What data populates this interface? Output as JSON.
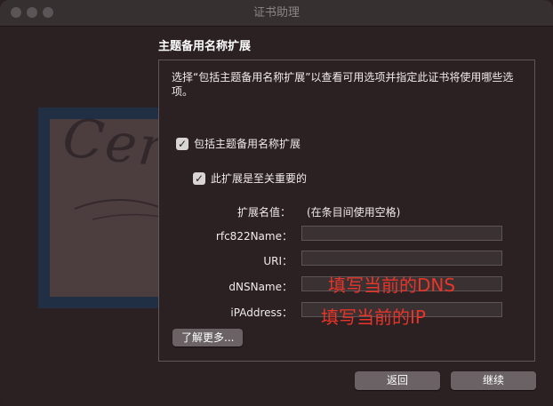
{
  "window": {
    "title": "证书助理"
  },
  "section": {
    "heading": "主题备用名称扩展",
    "description": "选择“包括主题备用名称扩展”以查看可用选项并指定此证书将使用哪些选项。"
  },
  "illustration": {
    "cert_text": "Certificate"
  },
  "options": {
    "include_ext": {
      "label": "包括主题备用名称扩展",
      "checked": true,
      "mark": "✓"
    },
    "critical_ext": {
      "label": "此扩展是至关重要的",
      "checked": true,
      "mark": "✓"
    }
  },
  "ext_values": {
    "label": "扩展名值：",
    "hint": "(在条目间使用空格)"
  },
  "fields": [
    {
      "label": "rfc822Name：",
      "value": ""
    },
    {
      "label": "URI：",
      "value": ""
    },
    {
      "label": "dNSName：",
      "value": ""
    },
    {
      "label": "iPAddress：",
      "value": ""
    }
  ],
  "annotations": {
    "dns": "填写当前的DNS",
    "ip": "填写当前的IP"
  },
  "buttons": {
    "learn_more": "了解更多...",
    "back": "返回",
    "continue": "继续"
  },
  "colors": {
    "annotation": "#e8352a",
    "background": "#2b2022"
  }
}
